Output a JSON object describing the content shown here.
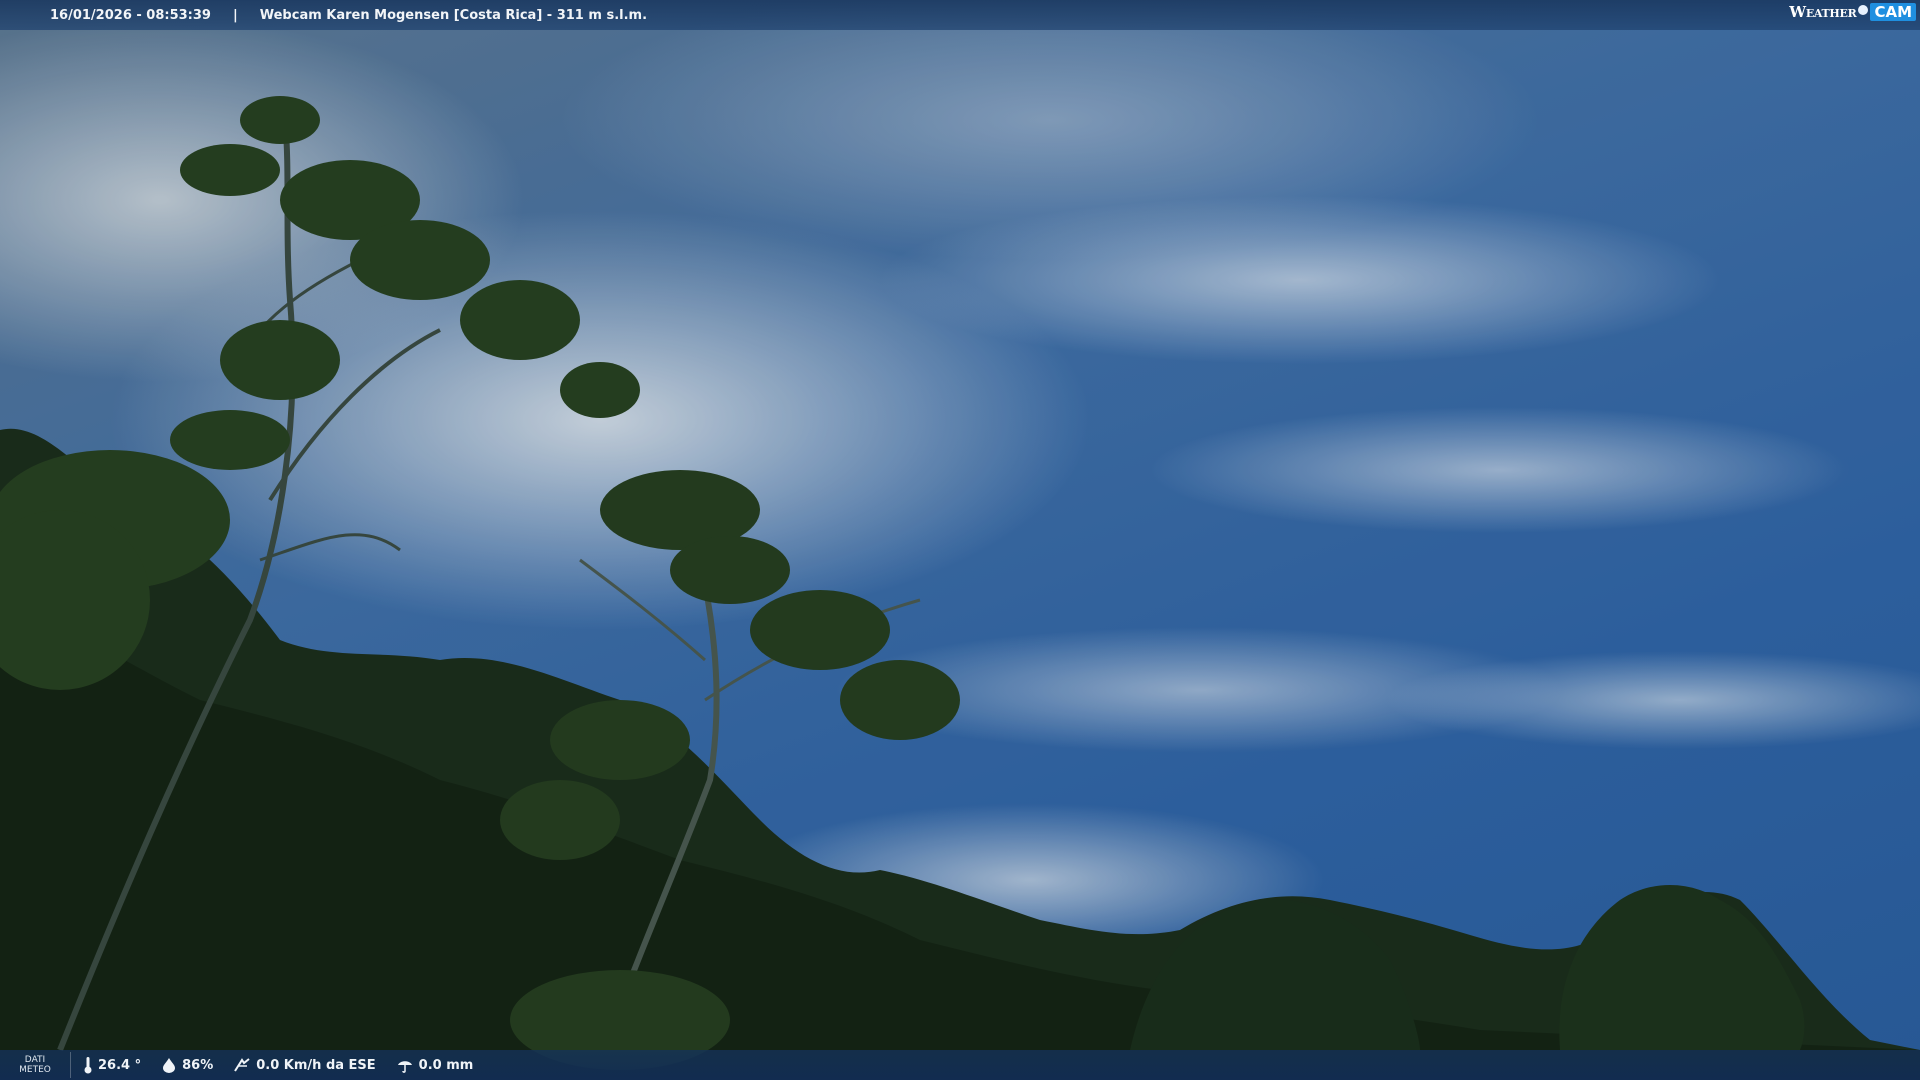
{
  "header": {
    "datetime": "16/01/2026 - 08:53:39",
    "separator": "|",
    "title": "Webcam Karen Mogensen [Costa Rica] - 311 m s.l.m."
  },
  "logo": {
    "weather": "Weather",
    "cam": "CAM"
  },
  "footer": {
    "dati_line1": "DATI",
    "dati_line2": "METEO",
    "temperature": "26.4 °",
    "humidity": "86%",
    "wind": "0.0 Km/h da ESE",
    "rain": "0.0 mm"
  },
  "icons": {
    "temperature": "thermometer-icon",
    "humidity": "humidity-drop-icon",
    "wind": "wind-icon",
    "rain": "rain-icon"
  },
  "colors": {
    "bar_background": "#1e4170",
    "logo_accent": "#1f8fe0"
  }
}
